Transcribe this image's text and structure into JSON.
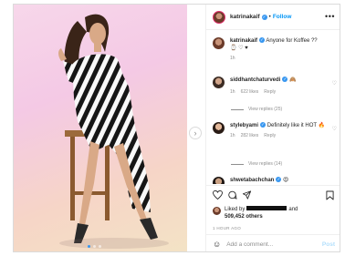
{
  "header": {
    "username": "katrinakaif",
    "separator": "•",
    "follow_label": "Follow",
    "more_icon": "more-icon"
  },
  "caption": {
    "username": "katrinakaif",
    "text": "Anyone for Koffee ??",
    "emojis": "⌚ ♡ ♥"
  },
  "caption_time": "1h",
  "comments": [
    {
      "username": "siddhantchaturvedi",
      "text": "",
      "emoji": "🙈",
      "time": "1h",
      "likes": "622 likes",
      "reply_label": "Reply",
      "view_replies": "View replies (25)"
    },
    {
      "username": "stylebyami",
      "text": "Definitely like it HOT",
      "emoji": "🔥",
      "time": "1h",
      "likes": "282 likes",
      "reply_label": "Reply",
      "view_replies": "View replies (14)"
    },
    {
      "username": "shwetabachchan",
      "text": "",
      "emoji": "😍"
    }
  ],
  "likes": {
    "prefix": "Liked by",
    "suffix": "and",
    "count": "509,452 others"
  },
  "timestamp": "1 HOUR AGO",
  "add_comment": {
    "placeholder": "Add a comment...",
    "post_label": "Post"
  },
  "colors": {
    "accent": "#0095f6",
    "verified": "#3897f0",
    "muted": "#8e8e8e"
  }
}
